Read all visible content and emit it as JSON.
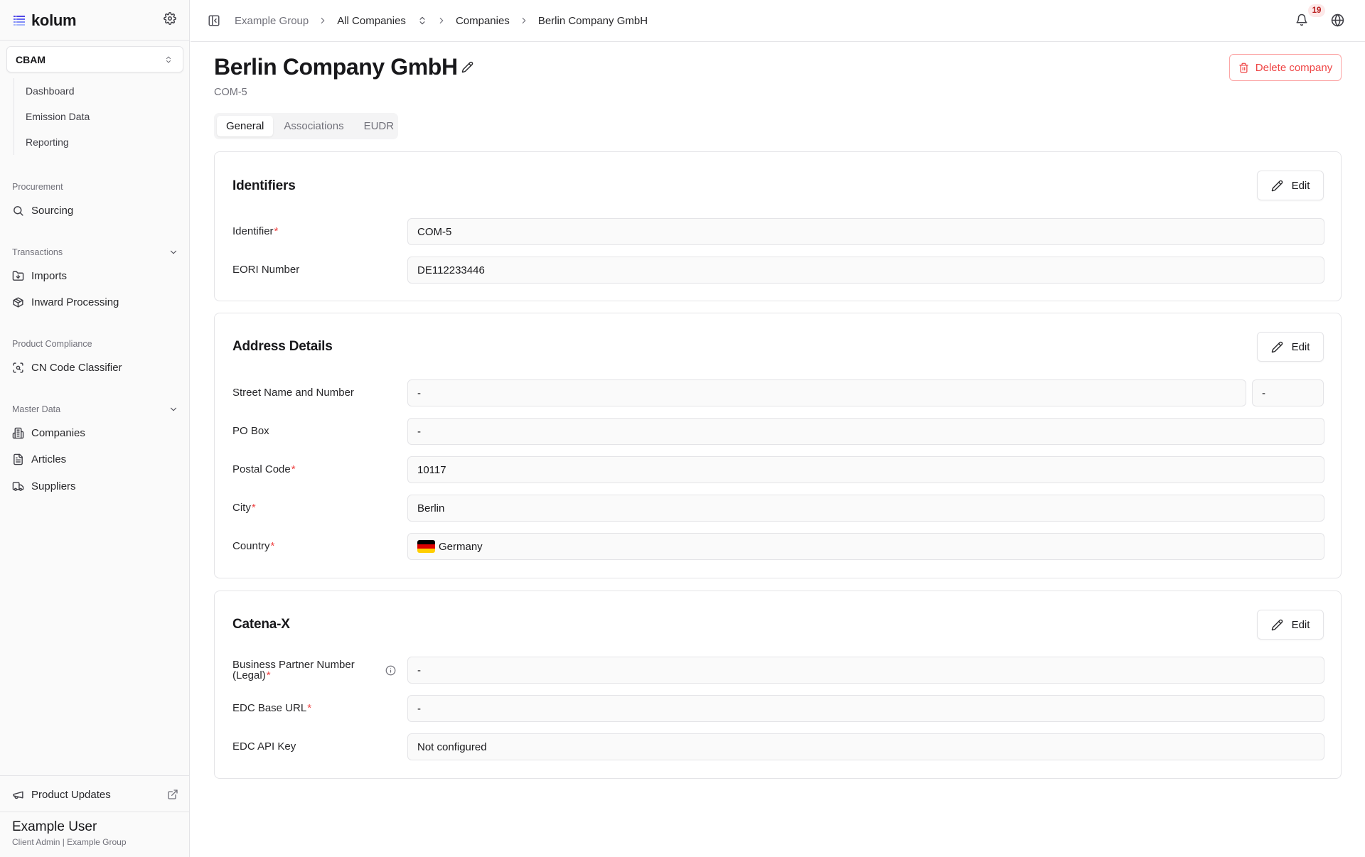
{
  "app": {
    "brand": "kolum",
    "module": "CBAM"
  },
  "sidebar": {
    "module_items": [
      "Dashboard",
      "Emission Data",
      "Reporting"
    ],
    "sections": {
      "procurement": {
        "label": "Procurement",
        "items": [
          "Sourcing"
        ]
      },
      "transactions": {
        "label": "Transactions",
        "items": [
          "Imports",
          "Inward Processing"
        ]
      },
      "product_compliance": {
        "label": "Product Compliance",
        "items": [
          "CN Code Classifier"
        ]
      },
      "master_data": {
        "label": "Master Data",
        "items": [
          "Companies",
          "Articles",
          "Suppliers"
        ]
      }
    },
    "product_updates": "Product Updates",
    "user": {
      "name": "Example User",
      "role": "Client Admin | Example Group"
    }
  },
  "topbar": {
    "breadcrumbs": [
      "Example Group",
      "All Companies",
      "Companies",
      "Berlin Company GmbH"
    ],
    "notification_count": "19"
  },
  "page": {
    "title": "Berlin Company GmbH",
    "subtitle": "COM-5",
    "delete_label": "Delete company",
    "tabs": [
      "General",
      "Associations",
      "EUDR"
    ],
    "active_tab": "General"
  },
  "cards": {
    "identifiers": {
      "title": "Identifiers",
      "edit_label": "Edit",
      "fields": {
        "identifier": {
          "label": "Identifier",
          "value": "COM-5"
        },
        "eori": {
          "label": "EORI Number",
          "value": "DE112233446"
        }
      }
    },
    "address": {
      "title": "Address Details",
      "edit_label": "Edit",
      "fields": {
        "street": {
          "label": "Street Name and Number",
          "value": "-",
          "number": "-"
        },
        "po_box": {
          "label": "PO Box",
          "value": "-"
        },
        "postal_code": {
          "label": "Postal Code",
          "value": "10117"
        },
        "city": {
          "label": "City",
          "value": "Berlin"
        },
        "country": {
          "label": "Country",
          "value": "Germany"
        }
      }
    },
    "catena": {
      "title": "Catena-X",
      "edit_label": "Edit",
      "fields": {
        "bpn_line1": "Business Partner Number",
        "bpn_line2": "(Legal)",
        "bpn_value": "-",
        "edc_url": {
          "label": "EDC Base URL",
          "value": "-"
        },
        "edc_key": {
          "label": "EDC API Key",
          "value": "Not configured"
        }
      }
    }
  },
  "colors": {
    "accent": "#4f46e5",
    "danger": "#ef4444",
    "flag_de": [
      "#000000",
      "#dd0000",
      "#ffce00"
    ]
  }
}
